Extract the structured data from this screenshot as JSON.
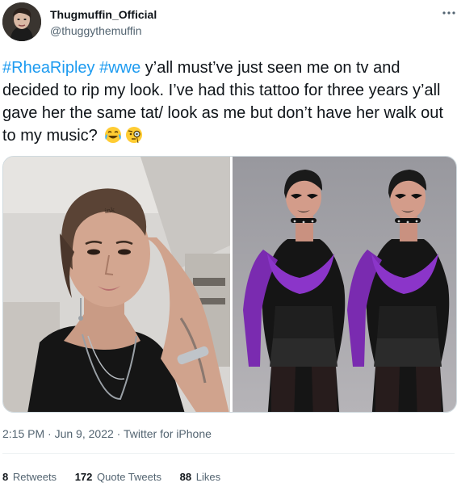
{
  "author": {
    "display_name": "Thugmuffin_Official",
    "handle": "@thuggythemuffin",
    "avatar_icon": "profile-photo"
  },
  "more_icon": "more-dots-icon",
  "tweet": {
    "hashtag_1": "#RheaRipley",
    "hashtag_2": "#wwe",
    "body": "y’all must’ve just seen me on tv and decided to rip my look. I’ve had this tattoo for three years y’all gave her the same tat/ look as me but don’t have her walk out to my music?",
    "emoji_1": "face-with-tears-of-joy",
    "emoji_2": "face-with-monocle"
  },
  "media": {
    "photos": [
      "selfie-photo",
      "wrestler-photo"
    ]
  },
  "meta": {
    "time": "2:15 PM",
    "sep": "·",
    "date": "Jun 9, 2022",
    "source": "Twitter for iPhone"
  },
  "stats": {
    "retweets_count": "8",
    "retweets_label": "Retweets",
    "quotes_count": "172",
    "quotes_label": "Quote Tweets",
    "likes_count": "88",
    "likes_label": "Likes"
  },
  "colors": {
    "link": "#1d9bf0",
    "text": "#0f1419",
    "secondary": "#536471",
    "border": "#eff3f4"
  }
}
